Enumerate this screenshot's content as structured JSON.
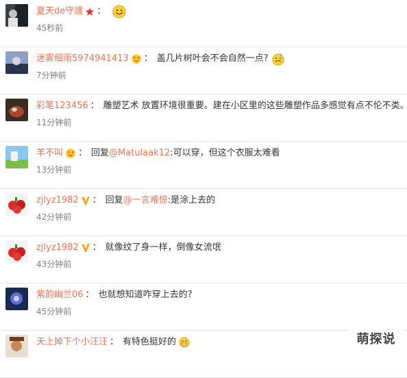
{
  "comments": [
    {
      "user": "夏天de守護",
      "badge": "star-icon",
      "sep": "：",
      "text": "",
      "emoji": "smile-emoji",
      "time": "45秒前"
    },
    {
      "user": "迷雾细雨5974941413",
      "badge": "heart-face-icon",
      "sep": "：",
      "text": "盖几片树叶会不会自然一点?",
      "emoji": "sweat-emoji",
      "time": "7分钟前"
    },
    {
      "user": "彩笔123456",
      "badge": "",
      "sep": "：",
      "text": "雕塑艺术 放置环境很重要。建在小区里的这些雕塑作品多感觉有点不伦不类。",
      "time": "11分钟前"
    },
    {
      "user": "羊不叫",
      "badge": "heart-face-icon",
      "sep": "：",
      "reply_prefix": "回复",
      "mention": "@Matulaak12",
      "text": ":可以穿，但这个衣服太难看",
      "time": "13分钟前"
    },
    {
      "user": "zjlyz1982",
      "badge": "vip-v-icon",
      "sep": "：",
      "reply_prefix": "回复",
      "mention": "@一言难惊",
      "text": ":是涂上去的",
      "time": "42分钟前"
    },
    {
      "user": "zjlyz1982",
      "badge": "vip-v-icon",
      "sep": "：",
      "text": "就像纹了身一样，倒像女流氓",
      "time": "43分钟前"
    },
    {
      "user": "紫韵幽兰06",
      "badge": "",
      "sep": "：",
      "text": "也就想知道咋穿上去的?",
      "time": "45分钟前"
    },
    {
      "user": "天上掉下个小汪汪",
      "badge": "",
      "sep": "：",
      "text": "有特色挺好的",
      "emoji": "grin-emoji",
      "time": ""
    }
  ],
  "watermark": "萌探说",
  "colors": {
    "username": "#eb7350",
    "text": "#333333",
    "time": "#808080",
    "divider": "#e6e6e6"
  }
}
